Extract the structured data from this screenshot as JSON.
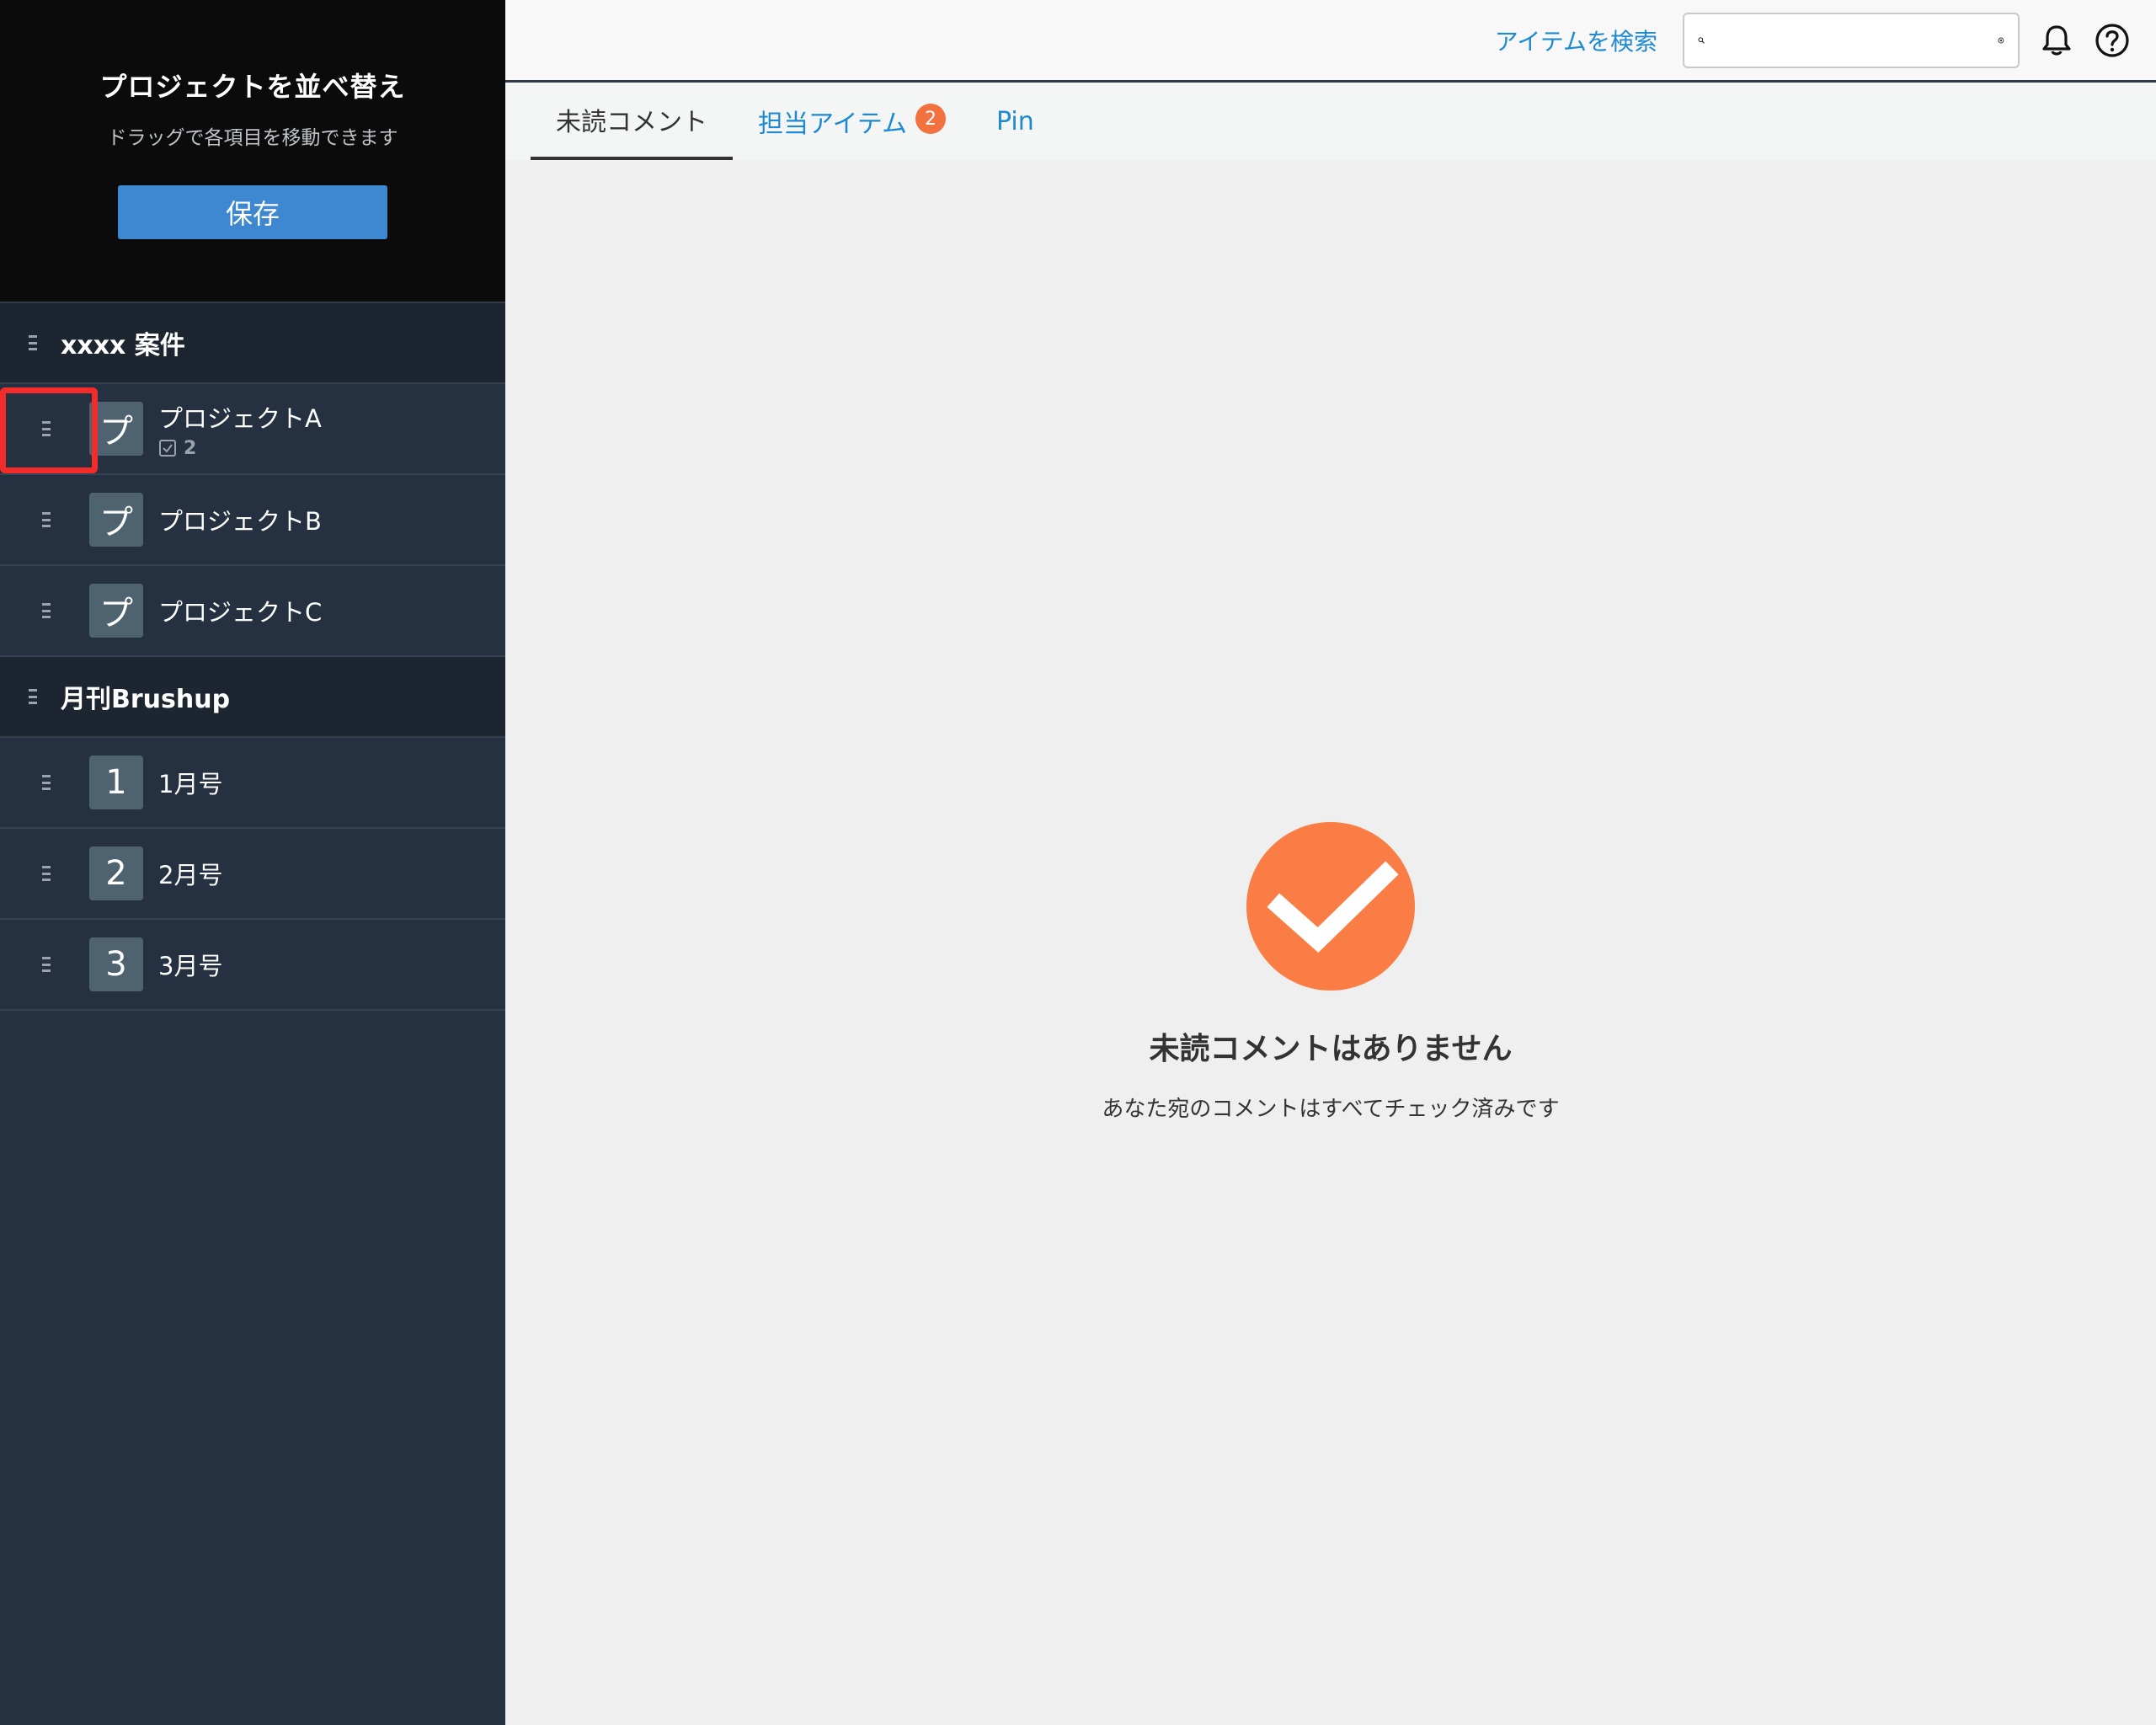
{
  "sidebar": {
    "reorder": {
      "title": "プロジェクトを並べ替え",
      "subtitle": "ドラッグで各項目を移動できます",
      "save_label": "保存"
    },
    "groups": [
      {
        "title": "xxxx 案件",
        "projects": [
          {
            "icon": "プ",
            "name": "プロジェクトA",
            "count": "2"
          },
          {
            "icon": "プ",
            "name": "プロジェクトB"
          },
          {
            "icon": "プ",
            "name": "プロジェクトC"
          }
        ]
      },
      {
        "title": "月刊Brushup",
        "projects": [
          {
            "icon": "1",
            "name": "1月号"
          },
          {
            "icon": "2",
            "name": "2月号"
          },
          {
            "icon": "3",
            "name": "3月号"
          }
        ]
      }
    ]
  },
  "topbar": {
    "search_link": "アイテムを検索",
    "search_value": ""
  },
  "tabs": [
    {
      "label": "未読コメント"
    },
    {
      "label": "担当アイテム",
      "badge": "2"
    },
    {
      "label": "Pin"
    }
  ],
  "empty_state": {
    "title": "未読コメントはありません",
    "subtitle": "あなた宛のコメントはすべてチェック済みです"
  },
  "colors": {
    "accent": "#1f8ad0",
    "save_button": "#3e88d2",
    "badge": "#f3703f",
    "highlight": "#f22b2b"
  },
  "icons": [
    "search-icon",
    "clear-icon",
    "bell-icon",
    "help-icon",
    "drag-handle-icon",
    "inbox-check-icon",
    "check-circle-icon"
  ]
}
